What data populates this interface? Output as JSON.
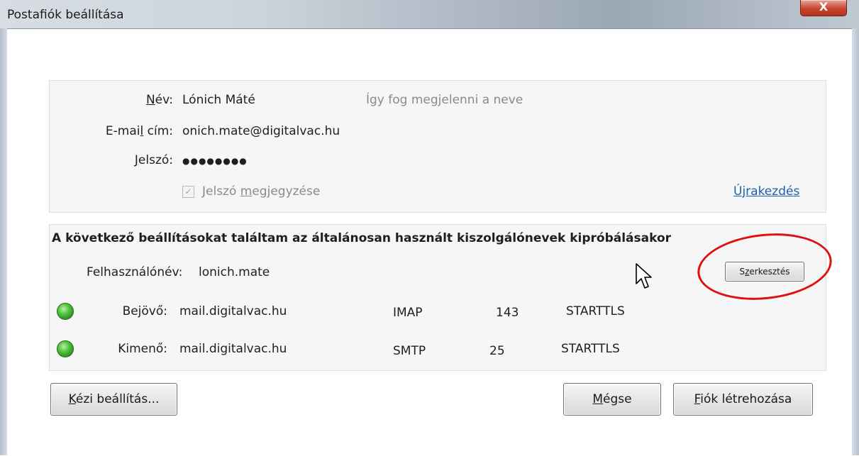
{
  "window": {
    "title": "Postafiók beállítása",
    "close_glyph": "X"
  },
  "account": {
    "name_label_pre": "",
    "name_label_u": "N",
    "name_label_post": "év:",
    "name_value": "Lónich Máté",
    "name_hint": "Így fog megjelenni a neve",
    "email_label_pre": "E-mai",
    "email_label_u": "l",
    "email_label_post": " cím:",
    "email_value": "onich.mate@digitalvac.hu",
    "password_label_pre": "",
    "password_label_u": "J",
    "password_label_post": "elszó:",
    "password_value": "●●●●●●●●",
    "remember_pre": "Jelszó ",
    "remember_u": "m",
    "remember_post": "egjegyzése",
    "remember_checked": true,
    "restart_link": "Újrakezdés"
  },
  "found": {
    "heading": "A következő beállításokat találtam az általánosan használt kiszolgálónevek kipróbálásakor",
    "username_label": "Felhasználónév:",
    "username_value": "lonich.mate",
    "edit_button_pre": "S",
    "edit_button_u": "z",
    "edit_button_post": "erkesztés",
    "incoming": {
      "label": "Bejövő:",
      "server": "mail.digitalvac.hu",
      "protocol": "IMAP",
      "port": "143",
      "security": "STARTTLS",
      "status_color": "#3cb32a"
    },
    "outgoing": {
      "label": "Kimenő:",
      "server": "mail.digitalvac.hu",
      "protocol": "SMTP",
      "port": "25",
      "security": "STARTTLS",
      "status_color": "#3cb32a"
    }
  },
  "buttons": {
    "manual_u": "K",
    "manual_post": "ézi beállítás...",
    "cancel_u": "M",
    "cancel_post": "égse",
    "create_u": "F",
    "create_post": "iók létrehozása"
  },
  "annotation": {
    "ring_color": "#e01010"
  }
}
